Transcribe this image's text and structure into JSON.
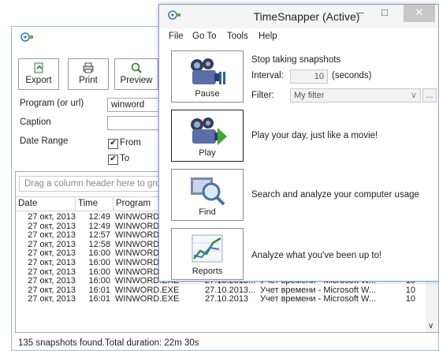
{
  "back_window": {
    "toolbar": {
      "export_label": "Export",
      "print_label": "Print",
      "preview_label": "Preview"
    },
    "filters": {
      "program_label": "Program (or url)",
      "program_value": "winword",
      "caption_label": "Caption",
      "caption_value": "",
      "date_range_label": "Date Range",
      "from_label": "From",
      "to_label": "To"
    },
    "grid": {
      "group_hint": "Drag a column header here to group",
      "columns": [
        "Date",
        "Time",
        "Program"
      ],
      "rows": [
        {
          "date": "27 окт, 2013",
          "time": "12:49",
          "program": "WINWORD",
          "start": "",
          "caption": "",
          "dur": ""
        },
        {
          "date": "27 окт, 2013",
          "time": "12:49",
          "program": "WINWORD",
          "start": "",
          "caption": "",
          "dur": ""
        },
        {
          "date": "27 окт, 2013",
          "time": "12:57",
          "program": "WINWORD",
          "start": "",
          "caption": "",
          "dur": ""
        },
        {
          "date": "27 окт, 2013",
          "time": "12:58",
          "program": "WINWORD",
          "start": "",
          "caption": "",
          "dur": ""
        },
        {
          "date": "27 окт, 2013",
          "time": "16:00",
          "program": "WINWORD.E",
          "start": "",
          "caption": "",
          "dur": ""
        },
        {
          "date": "27 окт, 2013",
          "time": "16:00",
          "program": "WINWORD.E",
          "start": "",
          "caption": "",
          "dur": ""
        },
        {
          "date": "27 окт, 2013",
          "time": "16:00",
          "program": "WINWORD.EXE",
          "start": "27.10.2013...",
          "caption": "Учет времени - Microsoft W...",
          "dur": "10"
        },
        {
          "date": "27 окт, 2013",
          "time": "16:00",
          "program": "WINWORD.EXE",
          "start": "27.10.2013...",
          "caption": "Учет времени - Microsoft W...",
          "dur": "10"
        },
        {
          "date": "27 окт, 2013",
          "time": "16:01",
          "program": "WINWORD.EXE",
          "start": "27.10.2013...",
          "caption": "Учет времени - Microsoft W...",
          "dur": "10"
        },
        {
          "date": "27 окт, 2013",
          "time": "16:01",
          "program": "WINWORD.EXE",
          "start": "27.10.2013",
          "caption": "Учет времени - Microsoft W...",
          "dur": "10"
        }
      ]
    },
    "status": "135 snapshots found.Total duration: 22m 30s"
  },
  "front_window": {
    "title": "TimeSnapper (Active)",
    "menu": [
      "File",
      "Go To",
      "Tools",
      "Help"
    ],
    "pause": {
      "label": "Pause",
      "heading": "Stop taking snapshots",
      "interval_label": "Interval:",
      "interval_value": "10",
      "interval_unit": "(seconds)",
      "filter_label": "Filter:",
      "filter_placeholder": "My filter",
      "filter_more": "..."
    },
    "play": {
      "label": "Play",
      "desc": "Play your day, just like a movie!"
    },
    "find": {
      "label": "Find",
      "desc": "Search and analyze your computer usage"
    },
    "reports": {
      "label": "Reports",
      "desc": "Analyze what you've been up to!"
    },
    "window_buttons": {
      "minimize": "–",
      "maximize": "□",
      "close": "✕"
    }
  }
}
